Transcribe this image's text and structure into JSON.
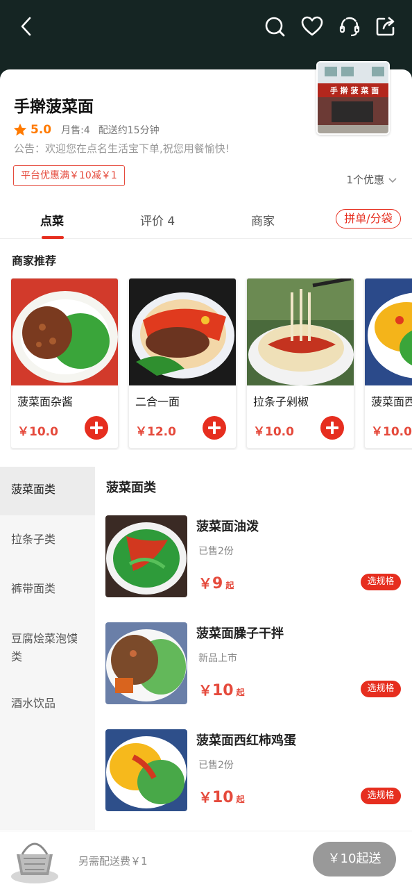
{
  "topbar": {
    "icons": [
      "back-icon",
      "search-icon",
      "heart-icon",
      "headset-icon",
      "share-icon"
    ],
    "bg_color": "#152523"
  },
  "shop": {
    "name": "手擀菠菜面",
    "sign_text": "手 擀 菠 菜 面",
    "rating": "5.0",
    "monthly_sales": "月售:4",
    "delivery_time": "配送约15分钟",
    "notice": "公告：欢迎您在点名生活宝下单,祝您用餐愉快!",
    "promo_tag": "平台优惠满￥10减￥1",
    "promo_count": "1个优惠"
  },
  "tabs": {
    "order": "点菜",
    "reviews": "评价 4",
    "merchant": "商家",
    "group_button": "拼单/分袋"
  },
  "recommend": {
    "title": "商家推荐",
    "items": [
      {
        "name": "菠菜面杂酱",
        "price": "￥10.0"
      },
      {
        "name": "二合一面",
        "price": "￥12.0"
      },
      {
        "name": "拉条子剁椒",
        "price": "￥10.0"
      },
      {
        "name": "菠菜面西",
        "price": "￥10.0"
      }
    ]
  },
  "categories": [
    {
      "label": "菠菜面类"
    },
    {
      "label": "拉条子类"
    },
    {
      "label": "裤带面类"
    },
    {
      "label": "豆腐烩菜泡馍类"
    },
    {
      "label": "酒水饮品"
    }
  ],
  "section": {
    "title": "菠菜面类",
    "items": [
      {
        "name": "菠菜面油泼",
        "sub": "已售2份",
        "currency": "￥",
        "price": "9",
        "suffix": "起",
        "button": "选规格"
      },
      {
        "name": "菠菜面臊子干拌",
        "sub": "新品上市",
        "currency": "￥",
        "price": "10",
        "suffix": "起",
        "button": "选规格"
      },
      {
        "name": "菠菜面西红柿鸡蛋",
        "sub": "已售2份",
        "currency": "￥",
        "price": "10",
        "suffix": "起",
        "button": "选规格"
      }
    ]
  },
  "cart": {
    "fee_text": "另需配送费￥1",
    "checkout_label": "￥10起送"
  },
  "colors": {
    "accent": "#e62e1f",
    "rating": "#ff7a00"
  }
}
